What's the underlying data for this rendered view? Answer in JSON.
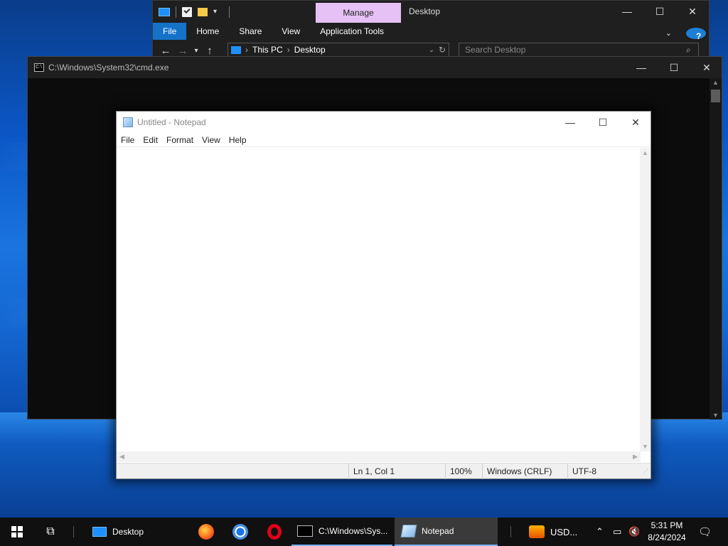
{
  "explorer": {
    "manage_tab": "Manage",
    "title": "Desktop",
    "ribbon": [
      "File",
      "Home",
      "Share",
      "View",
      "Application Tools"
    ],
    "breadcrumb": [
      "This PC",
      "Desktop"
    ],
    "search_placeholder": "Search Desktop",
    "help": "?"
  },
  "cmd": {
    "title": "C:\\Windows\\System32\\cmd.exe",
    "icon_text": "C:\\"
  },
  "notepad": {
    "title": "Untitled - Notepad",
    "menu": [
      "File",
      "Edit",
      "Format",
      "View",
      "Help"
    ],
    "content": "",
    "status": {
      "position": "Ln 1, Col 1",
      "zoom": "100%",
      "line_ending": "Windows (CRLF)",
      "encoding": "UTF-8"
    }
  },
  "taskbar": {
    "desktop_toolbar": "Desktop",
    "cmd_label": "C:\\Windows\\Sys...",
    "notepad_label": "Notepad",
    "weather_label": "USD...",
    "time": "5:31 PM",
    "date": "8/24/2024"
  },
  "colors": {
    "accent": "#1572c9",
    "manage_tab": "#e6c1f5",
    "taskbar": "#101010"
  }
}
